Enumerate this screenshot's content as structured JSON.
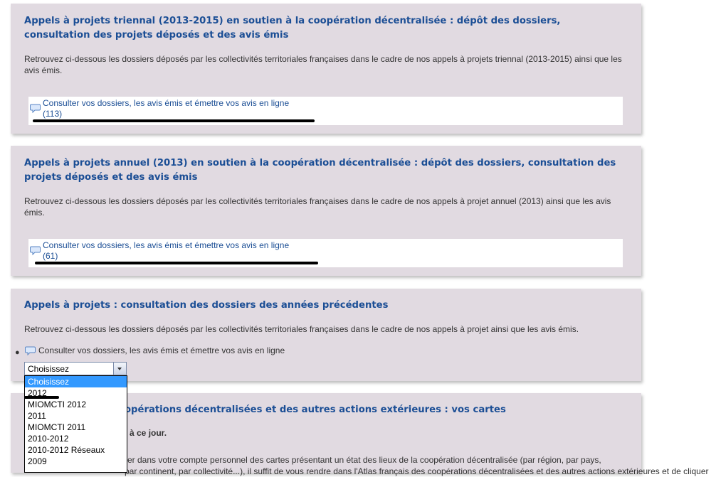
{
  "sections": [
    {
      "title": "Appels à projets triennal (2013-2015) en soutien à la coopération décentralisée : dépôt des dossiers, consultation des projets déposés et des avis émis",
      "description": "Retrouvez ci-dessous les dossiers déposés par les collectivités territoriales françaises dans le cadre de nos appels à projets triennal (2013-2015) ainsi que les avis émis.",
      "link_label": "Consulter vos dossiers, les avis émis et émettre vos avis en ligne",
      "link_count": "(113)"
    },
    {
      "title": "Appels à projets annuel (2013) en soutien à la coopération décentralisée : dépôt des dossiers, consultation des projets déposés et des avis émis",
      "description": "Retrouvez ci-dessous les dossiers déposés par les collectivités territoriales françaises dans le cadre de nos appels à projet annuel (2013) ainsi que les avis émis.",
      "link_label": "Consulter vos dossiers, les avis émis et émettre vos avis en ligne",
      "link_count": "(61)"
    },
    {
      "title": "Appels à projets : consultation des dossiers des années précédentes",
      "description": "Retrouvez ci-dessous les dossiers déposés par les collectivités territoriales françaises dans le cadre de nos appels à projet ainsi que les avis émis.",
      "link_label": "Consulter vos dossiers, les avis émis et émettre vos avis en ligne",
      "select_value": "Choisissez",
      "options": [
        "Choisissez",
        "2012",
        "MIOMCTI 2012",
        "2011",
        "MIOMCTI 2011",
        "2010-2012",
        "2010-2012 Réseaux",
        "2009"
      ]
    },
    {
      "title_visible": "opérations décentralisées et des autres actions extérieures : vos cartes",
      "subtitle_visible": "à ce jour.",
      "body_line1": "rer dans votre compte personnel des cartes présentant un état des lieux de la coopération décentralisée (par région, par pays,",
      "body_line2": "par continent, par collectivité...), il suffit de vous rendre dans l'Atlas français des coopérations décentralisées et des autres actions extérieures et de cliquer"
    }
  ],
  "colors": {
    "title": "#1b4e95",
    "panel_bg": "#e1dae1",
    "selected_option": "#3399ff"
  }
}
